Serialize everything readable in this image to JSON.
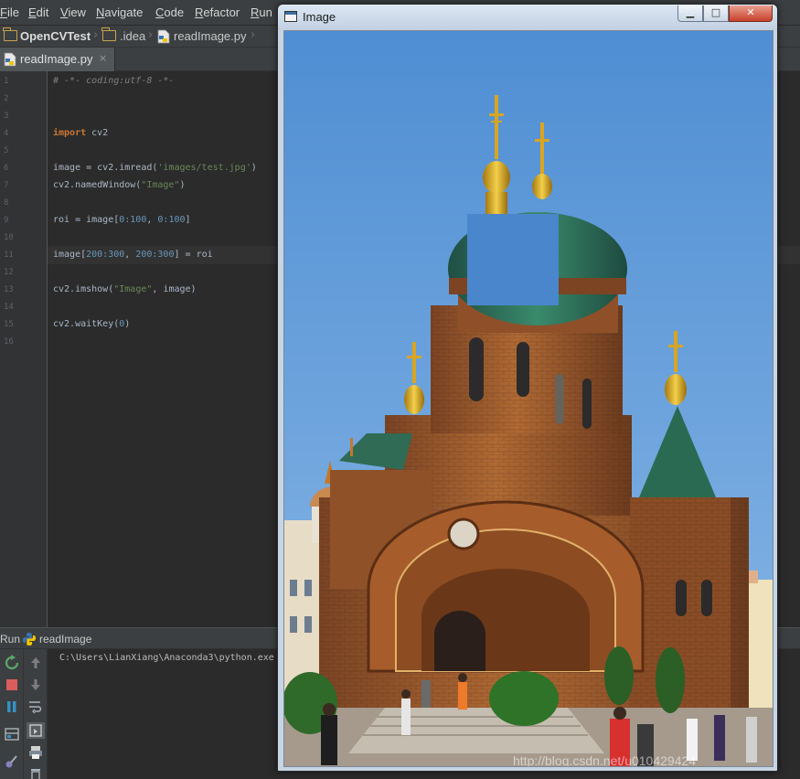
{
  "menu": [
    "File",
    "Edit",
    "View",
    "Navigate",
    "Code",
    "Refactor",
    "Run"
  ],
  "breadcrumb": {
    "project": "OpenCVTest",
    "folder": ".idea",
    "file": "readImage.py"
  },
  "editor_tab": {
    "label": "readImage.py",
    "close_glyph": "×"
  },
  "code": {
    "line_numbers": [
      "1",
      "2",
      "3",
      "4",
      "5",
      "6",
      "7",
      "8",
      "9",
      "10",
      "11",
      "12",
      "13",
      "14",
      "15",
      "16"
    ],
    "l1": "# -*- coding:utf-8 -*-",
    "l4_kw": "import",
    "l4_rest": " cv2",
    "l6_a": "image = cv2.imread(",
    "l6_s": "'images/test.jpg'",
    "l6_b": ")",
    "l7_a": "cv2.namedWindow(",
    "l7_s": "\"Image\"",
    "l7_b": ")",
    "l9_a": "roi = image[",
    "l9_n1": "0:100",
    "l9_c": ", ",
    "l9_n2": "0:100",
    "l9_b": "]",
    "l11_a": "image[",
    "l11_n1": "200:300",
    "l11_c": ", ",
    "l11_n2": "200:300",
    "l11_b": "] = roi",
    "l13_a": "cv2.imshow(",
    "l13_s": "\"Image\"",
    "l13_b": ", image)",
    "l15_a": "cv2.waitKey(",
    "l15_n": "0",
    "l15_b": ")"
  },
  "run": {
    "label": "Run",
    "config": "readImage",
    "console": "C:\\Users\\LianXiang\\Anaconda3\\python.exe"
  },
  "image_window": {
    "title": "Image",
    "min_glyph": "▁",
    "max_glyph": "□",
    "close_glyph": "✕",
    "watermark": "http://blog.csdn.net/u010429424"
  },
  "colors": {
    "sky": "#4f8ed3",
    "roi_patch": "#4a86cc",
    "brick": "#9a5b2e",
    "dome_green": "#2e6b56",
    "gold": "#d9a520",
    "keyword": "#cc7832",
    "string": "#6a8759",
    "number": "#6897bb"
  }
}
